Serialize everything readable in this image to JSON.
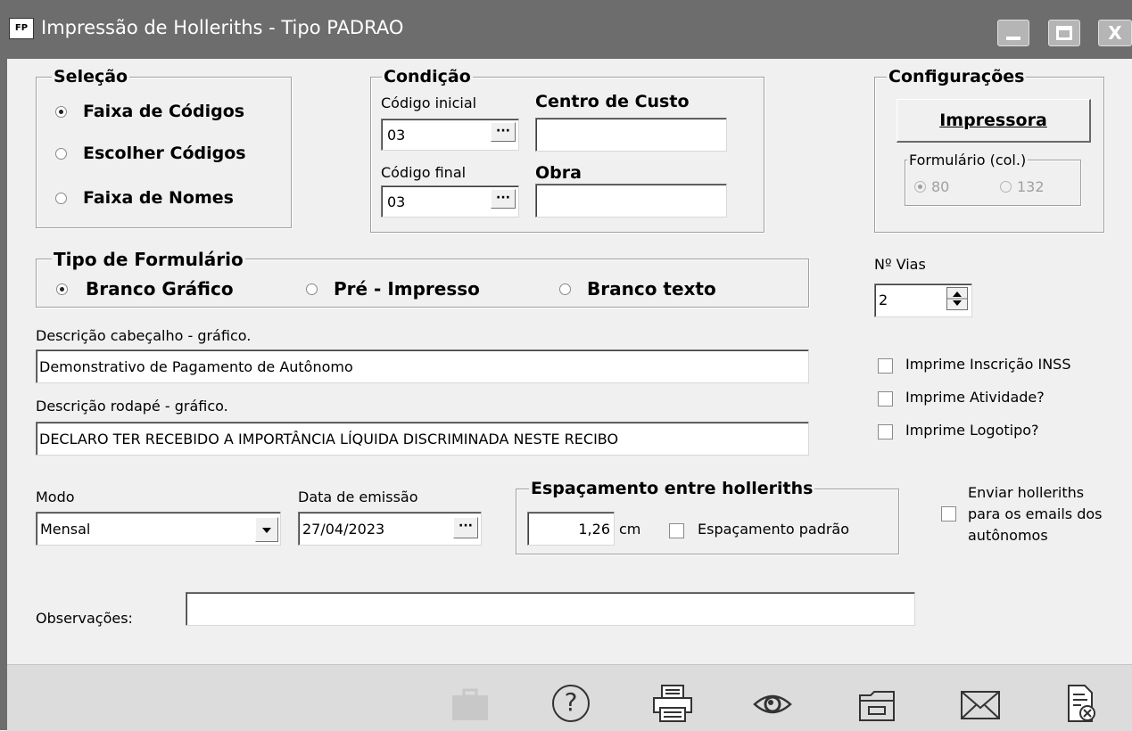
{
  "window": {
    "app_icon_text": "FP",
    "title": "Impressão de Holleriths  - Tipo PADRAO",
    "minimize_icon": "minimize-icon",
    "maximize_icon": "maximize-icon",
    "close_glyph": "X"
  },
  "selecao": {
    "legend": "Seleção",
    "options": [
      {
        "label": "Faixa de Códigos",
        "selected": true
      },
      {
        "label": "Escolher Códigos",
        "selected": false
      },
      {
        "label": "Faixa de Nomes",
        "selected": false
      }
    ]
  },
  "condicao": {
    "legend": "Condição",
    "codigo_inicial_label": "Código inicial",
    "codigo_inicial_value": "03",
    "codigo_final_label": "Código final",
    "codigo_final_value": "03",
    "centro_custo_label": "Centro de Custo",
    "centro_custo_value": "",
    "obra_label": "Obra",
    "obra_value": "",
    "ellipsis": "···"
  },
  "configuracoes": {
    "legend": "Configurações",
    "impressora_button": "Impressora",
    "formulario_legend": "Formulário (col.)",
    "col_80": "80",
    "col_132": "132"
  },
  "tipo_formulario": {
    "legend": "Tipo de Formulário",
    "options": [
      {
        "label": "Branco Gráfico",
        "selected": true
      },
      {
        "label": "Pré - Impresso",
        "selected": false
      },
      {
        "label": "Branco texto",
        "selected": false
      }
    ]
  },
  "vias": {
    "label": "Nº Vias",
    "value": "2"
  },
  "cabecalho": {
    "label": "Descrição cabeçalho - gráfico.",
    "value": "Demonstrativo de Pagamento de Autônomo"
  },
  "rodape": {
    "label": "Descrição rodapé - gráfico.",
    "value": "DECLARO TER RECEBIDO A IMPORTÂNCIA LÍQUIDA DISCRIMINADA NESTE RECIBO"
  },
  "checkboxes": {
    "inscricao_inss": "Imprime Inscrição INSS",
    "atividade": "Imprime Atividade?",
    "logotipo": "Imprime Logotipo?"
  },
  "modo": {
    "label": "Modo",
    "value": "Mensal"
  },
  "data_emissao": {
    "label": "Data de emissão",
    "value": "27/04/2023"
  },
  "espacamento": {
    "legend": "Espaçamento entre holleriths",
    "value": "1,26",
    "unit": "cm",
    "padrao_label": "Espaçamento padrão"
  },
  "enviar_emails": {
    "line1": "Enviar holleriths",
    "line2": "para os emails dos",
    "line3": "autônomos"
  },
  "observacoes": {
    "label": "Observações:",
    "value": ""
  },
  "toolbar": {
    "icons": [
      "briefcase-icon",
      "help-icon",
      "printer-icon",
      "preview-eye-icon",
      "open-folder-icon",
      "email-icon",
      "cancel-document-icon"
    ],
    "help_glyph": "?"
  },
  "colors": {
    "titlebar": "#6d6d6d",
    "window_bg": "#f0f0f0",
    "footer": "#dcdcdc"
  }
}
